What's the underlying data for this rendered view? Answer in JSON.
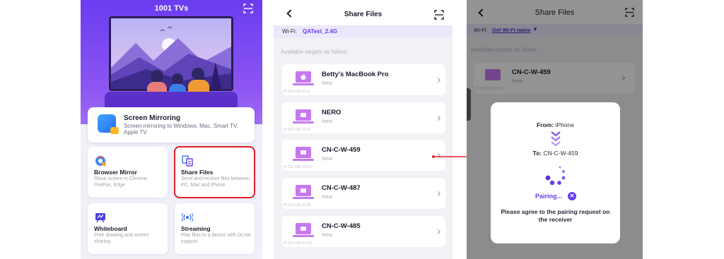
{
  "screen1": {
    "app_title": "1001 TVs",
    "screen_mirroring": {
      "title": "Screen Mirroring",
      "subtitle": "Screen mirroring to Windows, Mac, Smart TV, Apple TV"
    },
    "tiles": [
      {
        "title": "Browser Mirror",
        "subtitle": "Show screen in Chrome, FireFox, Edge"
      },
      {
        "title": "Share Files",
        "subtitle": "Send and receive files between PC, Mac and Phone"
      },
      {
        "title": "Whiteboard",
        "subtitle": "Free drawing and screen sharing"
      },
      {
        "title": "Streaming",
        "subtitle": "Play files to a device with DLNA support"
      }
    ],
    "highlight_color": "#e0202e"
  },
  "screen2": {
    "title": "Share Files",
    "wifi_label": "Wi-Fi:",
    "wifi_name": "QATest_2.4G",
    "available_label": "Available targets as follow:",
    "devices": [
      {
        "name": "Betty's MacBook Pro",
        "status": "New",
        "ip": "IP:192.168.10.51",
        "icon": "mac-laptop-icon"
      },
      {
        "name": "NERO",
        "status": "New",
        "ip": "IP:192.168.10.75",
        "icon": "windows-laptop-icon"
      },
      {
        "name": "CN-C-W-459",
        "status": "New",
        "ip": "IP:192.168.10.107",
        "icon": "windows-laptop-icon"
      },
      {
        "name": "CN-C-W-487",
        "status": "New",
        "ip": "IP:192.168.10.98",
        "icon": "windows-laptop-icon"
      },
      {
        "name": "CN-C-W-485",
        "status": "New",
        "ip": "IP:192.168.10.136",
        "icon": "windows-laptop-icon"
      }
    ]
  },
  "screen3": {
    "title": "Share Files",
    "wifi_label": "Wi-Fi:",
    "wifi_link": "Get Wi-Fi name",
    "available_label": "Available targets as follow:",
    "device": {
      "name": "CN-C-W-459",
      "status": "New",
      "ip": "IP:192.168.10.107"
    },
    "dialog": {
      "from_label": "From:",
      "from_value": "iPhone",
      "to_label": "To:",
      "to_value": "CN-C-W-459",
      "status": "Pairing...",
      "message": "Please agree to the pairing request on the receiver"
    }
  },
  "colors": {
    "accent": "#6a3cf0",
    "arrow": "#e0202e"
  }
}
